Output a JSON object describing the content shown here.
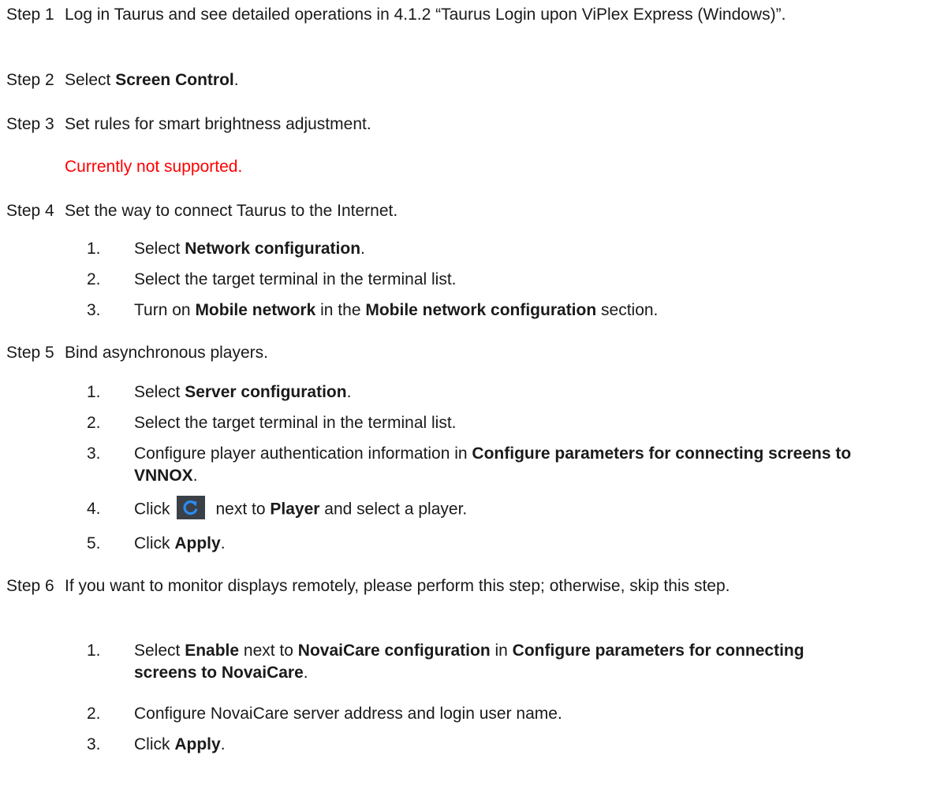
{
  "steps": [
    {
      "label": "Step 1",
      "text": "Log in Taurus and see detailed operations in 4.1.2 “Taurus Login upon ViPlex Express (Windows)”."
    },
    {
      "label": "Step 2",
      "pre": "Select ",
      "bold": "Screen Control",
      "post": "."
    },
    {
      "label": "Step 3",
      "text": "Set rules for smart brightness adjustment.",
      "note": "Currently not supported."
    },
    {
      "label": "Step 4",
      "text": "Set the way to connect Taurus to the Internet.",
      "substeps": [
        {
          "num": "1.",
          "pre": "Select ",
          "bold1": "Network configuration",
          "post": "."
        },
        {
          "num": "2.",
          "text": "Select the target terminal in the terminal list."
        },
        {
          "num": "3.",
          "pre": "Turn on ",
          "bold1": "Mobile network",
          "mid": " in the ",
          "bold2": "Mobile network configuration",
          "post": " section."
        }
      ]
    },
    {
      "label": "Step 5",
      "text": "Bind asynchronous players.",
      "substeps": [
        {
          "num": "1.",
          "pre": "Select ",
          "bold1": "Server configuration",
          "post": "."
        },
        {
          "num": "2.",
          "text": "Select the target terminal in the terminal list."
        },
        {
          "num": "3.",
          "pre": "Configure player authentication information in ",
          "bold1": "Configure parameters for connecting screens to VNNOX",
          "post": "."
        },
        {
          "num": "4.",
          "pre": "Click",
          "icon": "refresh-icon",
          "mid": "next to ",
          "bold1": "Player",
          "post": " and select a player."
        },
        {
          "num": "5.",
          "pre": "Click ",
          "bold1": "Apply",
          "post": "."
        }
      ]
    },
    {
      "label": "Step 6",
      "text": "If you want to monitor displays remotely, please perform this step; otherwise, skip this step.",
      "substeps": [
        {
          "num": "1.",
          "pre": "Select ",
          "bold1": "Enable",
          "mid": " next to ",
          "bold2": "NovaiCare configuration",
          "mid2": " in ",
          "bold3": "Configure parameters for connecting screens to NovaiCare",
          "post": "."
        },
        {
          "num": "2.",
          "text": "Configure NovaiCare server address and login user name."
        },
        {
          "num": "3.",
          "pre": "Click ",
          "bold1": "Apply",
          "post": "."
        }
      ]
    }
  ],
  "colors": {
    "note": "#ff0000",
    "icon_bg": "#3a4048",
    "icon_arrow": "#2b8cf0"
  }
}
